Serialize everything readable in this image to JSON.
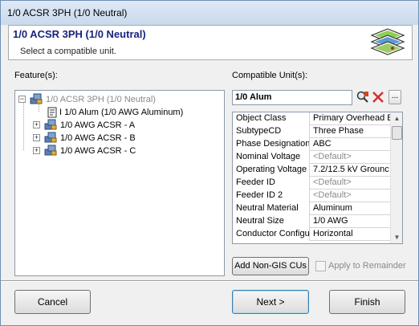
{
  "window": {
    "title": "1/0 ACSR 3PH (1/0 Neutral)"
  },
  "header": {
    "title": "1/0 ACSR 3PH (1/0 Neutral)",
    "subtitle": "Select a compatible unit."
  },
  "features": {
    "label": "Feature(s):",
    "tree": [
      {
        "text": "1/0 ACSR 3PH (1/0 Neutral)",
        "expanded": true,
        "grayed": true
      },
      {
        "text": "I 1/0 Alum (1/0 AWG Aluminum)"
      },
      {
        "text": "1/0 AWG ACSR - A",
        "expander": "+"
      },
      {
        "text": "1/0 AWG ACSR - B",
        "expander": "+"
      },
      {
        "text": "1/0 AWG ACSR - C",
        "expander": "+"
      }
    ]
  },
  "compatible": {
    "label": "Compatible Unit(s):",
    "selected": "1/0 Alum",
    "ellipsis": "...",
    "properties": [
      {
        "key": "Object Class",
        "value": "Primary Overhead E"
      },
      {
        "key": "SubtypeCD",
        "value": "Three Phase"
      },
      {
        "key": "Phase Designation",
        "value": "ABC"
      },
      {
        "key": "Nominal Voltage",
        "value": "<Default>",
        "default": true
      },
      {
        "key": "Operating Voltage",
        "value": "7.2/12.5 kV Grounc"
      },
      {
        "key": "Feeder ID",
        "value": "<Default>",
        "default": true
      },
      {
        "key": "Feeder ID 2",
        "value": "<Default>",
        "default": true
      },
      {
        "key": "Neutral Material",
        "value": "Aluminum"
      },
      {
        "key": "Neutral Size",
        "value": "1/0 AWG"
      },
      {
        "key": "Conductor Configur",
        "value": "Horizontal"
      }
    ]
  },
  "buttons": {
    "add_non_gis": "Add Non-GIS CUs",
    "apply_remainder": "Apply to Remainder",
    "cancel": "Cancel",
    "next": "Next >",
    "finish": "Finish"
  }
}
